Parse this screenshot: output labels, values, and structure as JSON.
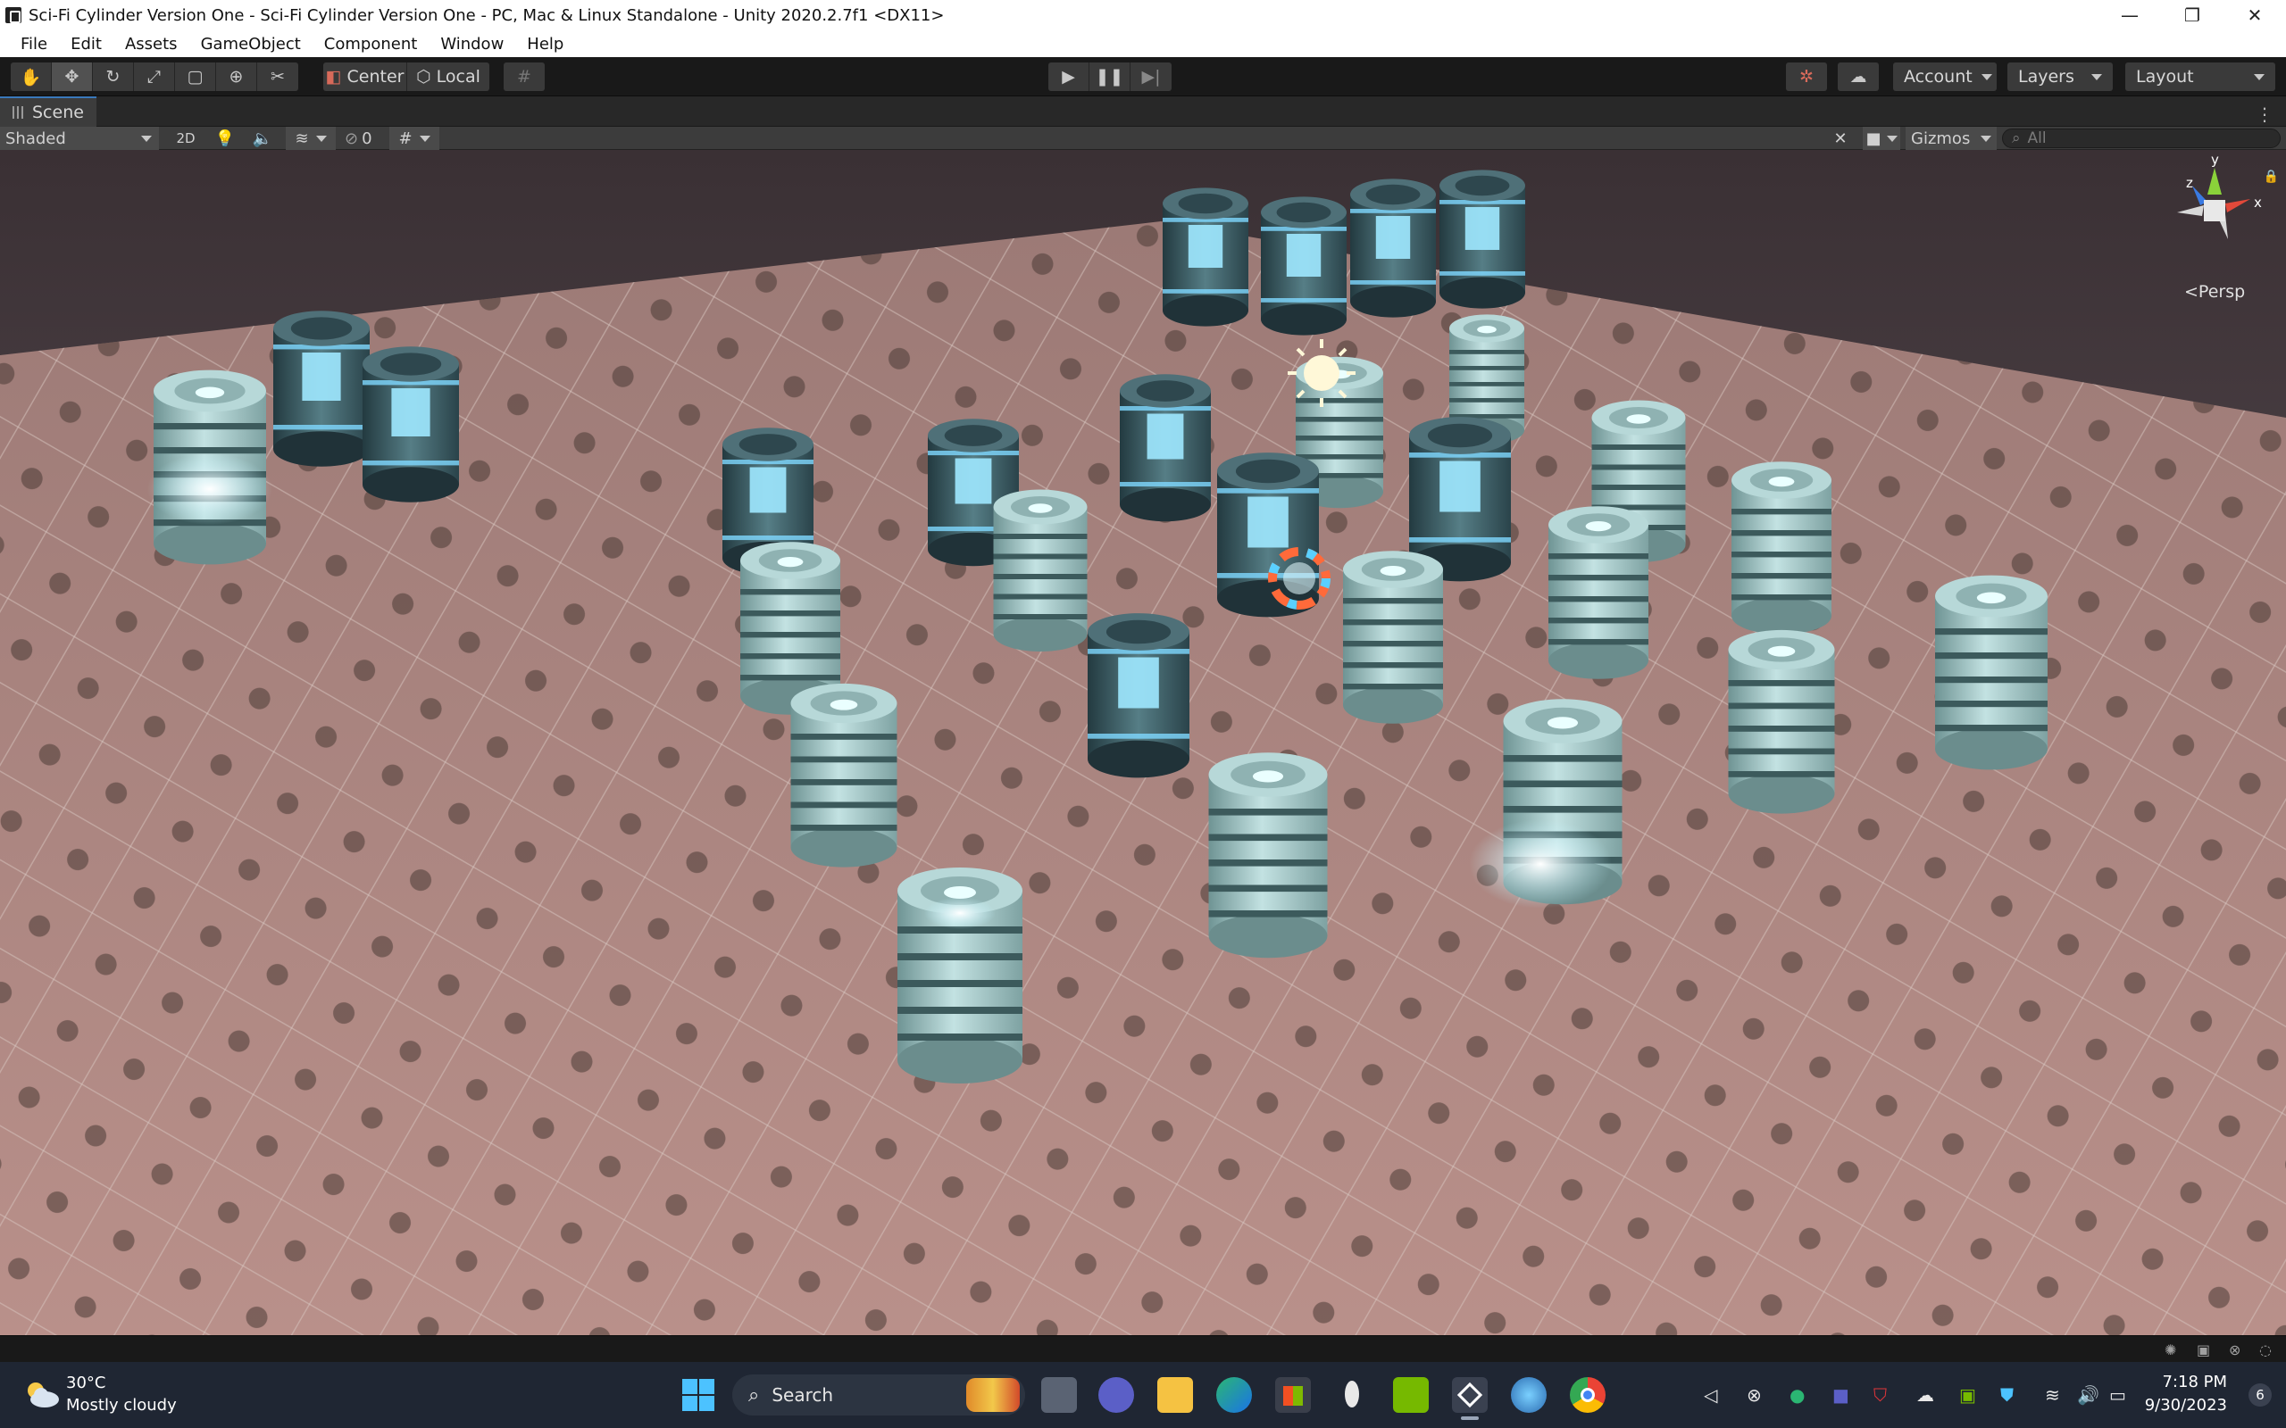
{
  "window": {
    "title": "Sci-Fi Cylinder Version One - Sci-Fi Cylinder Version One - PC, Mac & Linux Standalone - Unity 2020.2.7f1 <DX11>",
    "controls": {
      "minimize": "—",
      "restore": "❐",
      "close": "✕"
    }
  },
  "menu": [
    "File",
    "Edit",
    "Assets",
    "GameObject",
    "Component",
    "Window",
    "Help"
  ],
  "toolbar": {
    "pivot_label": "Center",
    "space_label": "Local",
    "account_label": "Account",
    "layers_label": "Layers",
    "layout_label": "Layout"
  },
  "scene_tab": {
    "label": "Scene"
  },
  "scene_bar": {
    "draw_mode": "Shaded",
    "mode_2d": "2D",
    "hidden_count": "0",
    "gizmos_label": "Gizmos",
    "search_placeholder": "All"
  },
  "orientation_gizmo": {
    "y_label": "y",
    "z_label": "z",
    "x_label": "x",
    "projection": "<Persp"
  },
  "taskbar": {
    "weather_temp": "30°C",
    "weather_desc": "Mostly cloudy",
    "search_label": "Search",
    "time": "7:18 PM",
    "date": "9/30/2023",
    "notification_count": "6"
  },
  "colors": {
    "editor_dark": "#191919",
    "panel": "#3c3c3c",
    "accent": "#3a79bb",
    "taskbar": "#1f2633",
    "floor": "#b08a84",
    "cylinder": "#a9cccc",
    "glow": "#e8ffff"
  }
}
